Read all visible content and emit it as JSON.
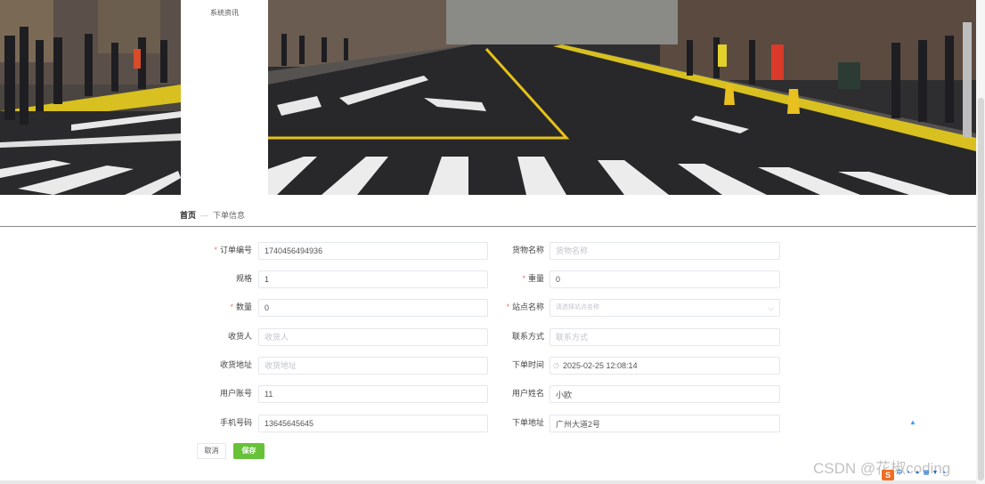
{
  "menu": {
    "item": "系统资讯"
  },
  "breadcrumb": {
    "home": "首页",
    "separator": "—",
    "current": "下单信息"
  },
  "form": {
    "order_no": {
      "label": "订单编号",
      "value": "1740456494936"
    },
    "goods_name": {
      "label": "货物名称",
      "placeholder": "货物名称"
    },
    "spec": {
      "label": "规格",
      "value": "1"
    },
    "weight": {
      "label": "重量",
      "value": "0"
    },
    "quantity": {
      "label": "数量",
      "value": "0"
    },
    "station": {
      "label": "站点名称",
      "placeholder": "请选择站点名称"
    },
    "receiver": {
      "label": "收货人",
      "placeholder": "收货人"
    },
    "contact": {
      "label": "联系方式",
      "placeholder": "联系方式"
    },
    "address": {
      "label": "收货地址",
      "placeholder": "收货地址"
    },
    "order_time": {
      "label": "下单时间",
      "value": "2025-02-25 12:08:14"
    },
    "account": {
      "label": "用户账号",
      "value": "11"
    },
    "username": {
      "label": "用户姓名",
      "value": "小欧"
    },
    "phone": {
      "label": "手机号码",
      "value": "13645645645"
    },
    "order_addr": {
      "label": "下单地址",
      "value": "广州大道2号"
    }
  },
  "buttons": {
    "cancel": "取消",
    "save": "保存"
  },
  "watermark": "CSDN @花椒coding",
  "tray": {
    "logo": "S",
    "ime": "中"
  },
  "colors": {
    "accent_green": "#67c23a",
    "required_red": "#f56c6c",
    "link_blue": "#409eff"
  }
}
